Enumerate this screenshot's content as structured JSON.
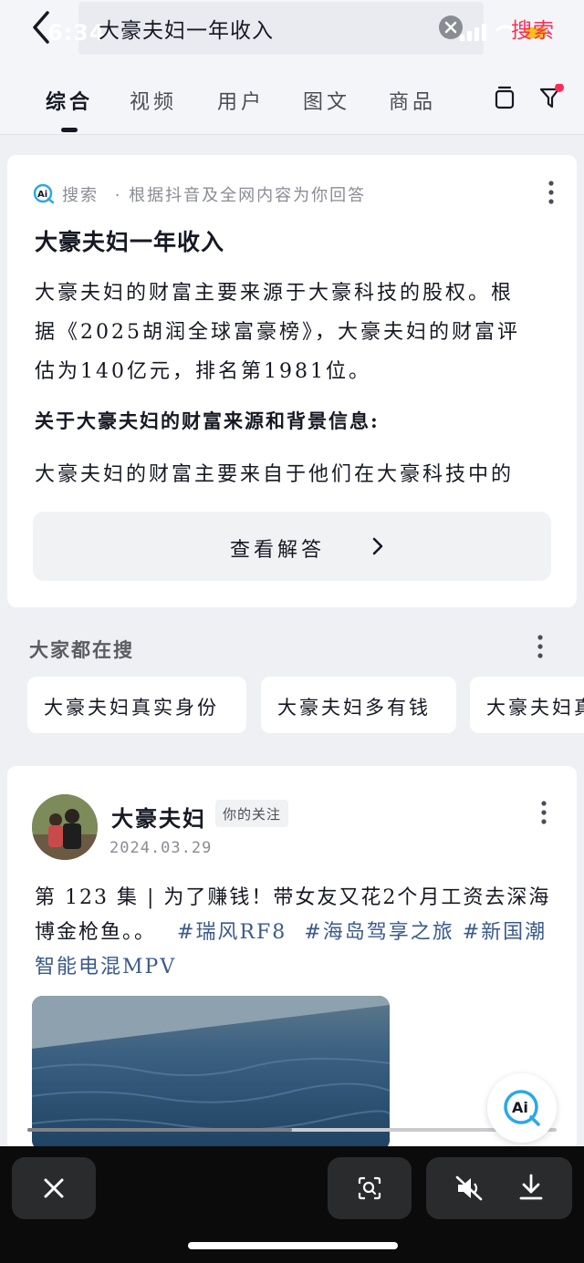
{
  "status_bar": {
    "time": "6:34"
  },
  "search": {
    "query": "大豪夫妇一年收入",
    "button_label": "搜索"
  },
  "tabs": [
    {
      "label": "综合",
      "active": true
    },
    {
      "label": "视频",
      "active": false
    },
    {
      "label": "用户",
      "active": false
    },
    {
      "label": "图文",
      "active": false
    },
    {
      "label": "商品",
      "active": false
    }
  ],
  "ai_answer": {
    "source_label": "搜索",
    "source_desc": "· 根据抖音及全网内容为你回答",
    "title": "大豪夫妇一年收入",
    "paragraph_lines": [
      "大豪夫妇的财富主要来源于大豪科技的股权。根",
      "据《2025胡润全球富豪榜》，大豪夫妇的财富评",
      "估为140亿元，排名第1981位。"
    ],
    "subheading": "关于大豪夫妇的财富来源和背景信息:",
    "paragraph2": "大豪夫妇的财富主要来自于他们在大豪科技中的",
    "view_answer_label": "查看解答"
  },
  "trending": {
    "title": "大家都在搜",
    "chips": [
      "大豪夫妇真实身份",
      "大豪夫妇多有钱",
      "大豪夫妇真"
    ]
  },
  "post": {
    "author": "大豪夫妇",
    "badge": "你的关注",
    "date": "2024.03.29",
    "text_main": "第 123 集 | 为了赚钱！带女友又花2个月工资去深海博金枪鱼。。",
    "hashtags": [
      "#瑞风RF8",
      "#海岛驾享之旅",
      "#新国潮智能电混MPV"
    ]
  },
  "video_progress": 0.5,
  "colors": {
    "accent": "#fe2c55",
    "hashtag": "#3b5a8c",
    "bottom_bar": "#0b0b0c"
  },
  "icons": [
    "back-icon",
    "clear-icon",
    "layout-icon",
    "filter-icon",
    "more-icon",
    "chevron-right-icon",
    "ai-icon",
    "close-icon",
    "scan-icon",
    "mute-icon",
    "download-icon"
  ]
}
